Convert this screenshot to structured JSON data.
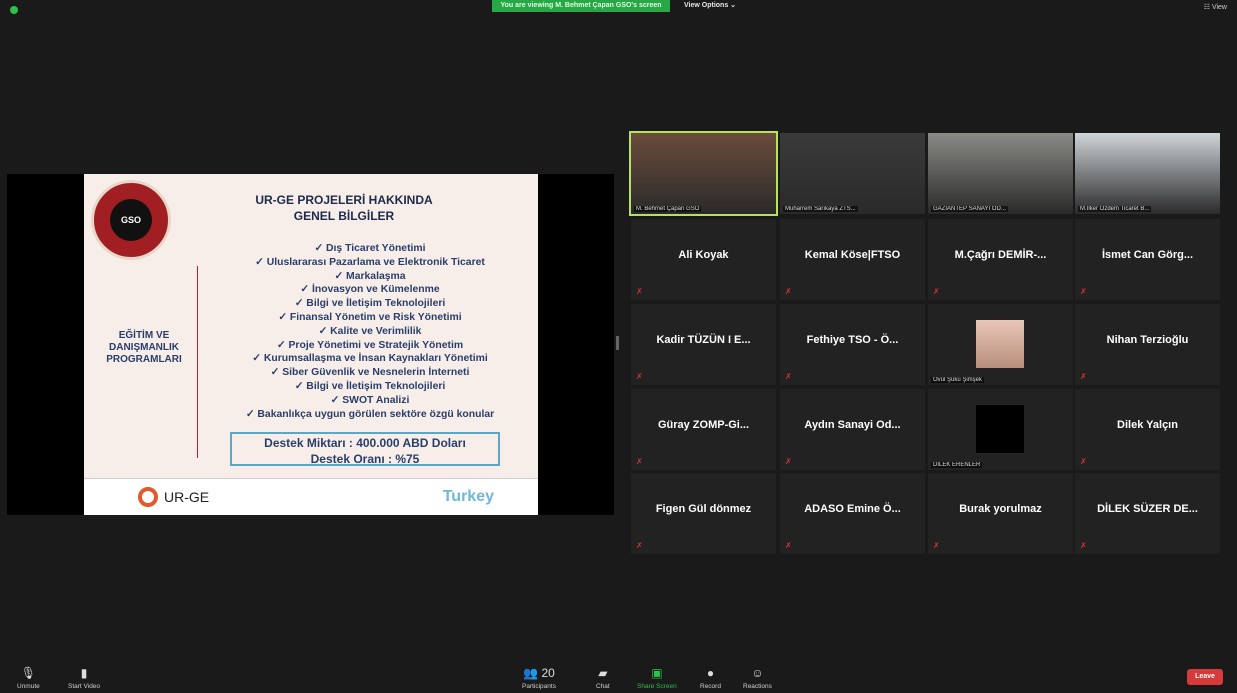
{
  "top": {
    "banner": "You are viewing M. Behmet Çapan GSO's screen",
    "view_options": "View Options ⌄",
    "view_button": "☷ View"
  },
  "slide": {
    "logo_text": "GSO",
    "title": "UR-GE PROJELERİ HAKKINDA\nGENEL BİLGİLER",
    "left_heading": "EĞİTİM VE\nDANIŞMANLIK\nPROGRAMLARI",
    "items": [
      "✓ Dış Ticaret Yönetimi",
      "✓ Uluslararası Pazarlama ve Elektronik Ticaret",
      "✓ Markalaşma",
      "✓ İnovasyon ve Kümelenme",
      "✓ Bilgi ve İletişim Teknolojileri",
      "✓ Finansal Yönetim ve Risk Yönetimi",
      "✓ Kalite ve Verimlilik",
      "✓ Proje Yönetimi ve Stratejik Yönetim",
      "✓ Kurumsallaşma ve İnsan Kaynakları Yönetimi",
      "✓ Siber Güvenlik ve Nesnelerin İnterneti",
      "✓ Bilgi ve İletişim Teknolojileri",
      "✓ SWOT Analizi",
      "✓ Bakanlıkça uygun görülen sektöre özgü konular"
    ],
    "box": "Destek Miktarı : 400.000 ABD Doları\nDestek Oranı : %75",
    "footer_left": "UR-GE",
    "footer_right": "Turkey"
  },
  "participants": [
    {
      "name": "M. Behmet Çapan GSO",
      "video": true,
      "active": true
    },
    {
      "name": "Muharrem Sarıkaya ZTS...",
      "video": true
    },
    {
      "name": "GAZİANTEP SANAYİ OD...",
      "video": true
    },
    {
      "name": "M.İlker Özdem Ticaret B...",
      "video": true
    },
    {
      "name": "Ali Koyak"
    },
    {
      "name": "Kemal Köse|FTSO"
    },
    {
      "name": "M.Çağrı DEMİR-..."
    },
    {
      "name": "İsmet Can Görg..."
    },
    {
      "name": "Kadir TÜZÜN I E..."
    },
    {
      "name": "Fethiye TSO - Ö..."
    },
    {
      "name": "Övül Şükü Şimşek",
      "avatar": true
    },
    {
      "name": "Nihan Terzioğlu"
    },
    {
      "name": "Güray ZOMP-Gi..."
    },
    {
      "name": "Aydın Sanayi Od..."
    },
    {
      "name": "DİLEK ERENLER",
      "avatar_black": true
    },
    {
      "name": "Dilek Yalçın"
    },
    {
      "name": "Figen Gül dönmez"
    },
    {
      "name": "ADASO Emine Ö..."
    },
    {
      "name": "Burak yorulmaz"
    },
    {
      "name": "DİLEK SÜZER DE..."
    }
  ],
  "toolbar": {
    "unmute": "Unmute",
    "start_video": "Start Video",
    "participants": "Participants",
    "participants_count": "20",
    "chat": "Chat",
    "share_screen": "Share Screen",
    "record": "Record",
    "reactions": "Reactions",
    "leave": "Leave"
  },
  "colors": {
    "accent_green": "#27a745",
    "leave_red": "#d63a3a",
    "active_speaker": "#b7e35a"
  }
}
